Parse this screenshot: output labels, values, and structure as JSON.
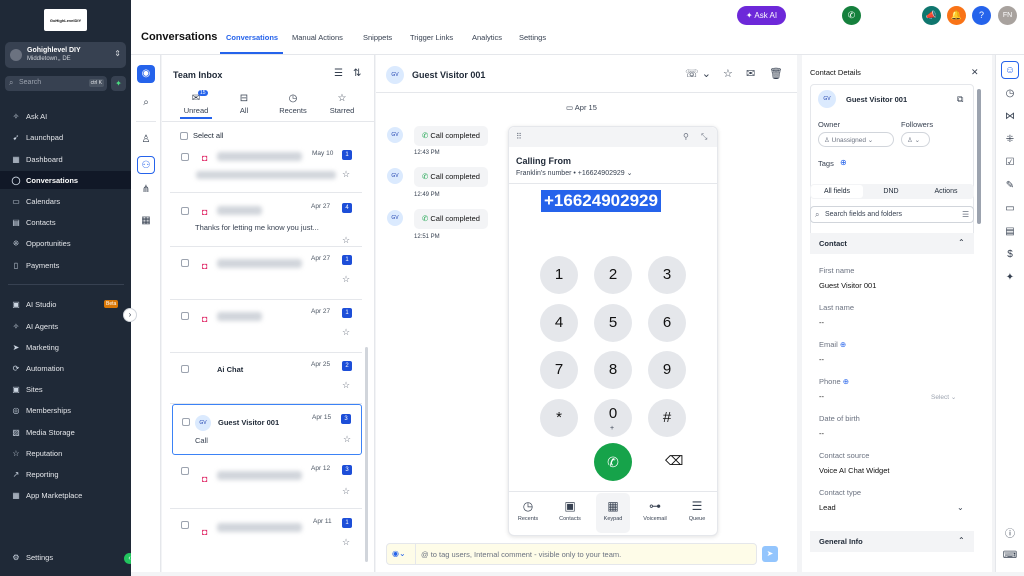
{
  "sidebar": {
    "logo_text": "GoHighLevelDIY",
    "location_name": "Gohighlevel DIY",
    "location_sub": "Middletown,, DE",
    "search_placeholder": "Search",
    "search_shortcut": "ctrl K",
    "items": [
      {
        "label": "Ask AI",
        "icon": "sparkle-icon"
      },
      {
        "label": "Launchpad",
        "icon": "rocket-icon"
      },
      {
        "label": "Dashboard",
        "icon": "grid-icon"
      },
      {
        "label": "Conversations",
        "icon": "chat-icon"
      },
      {
        "label": "Calendars",
        "icon": "calendar-icon"
      },
      {
        "label": "Contacts",
        "icon": "contacts-icon"
      },
      {
        "label": "Opportunities",
        "icon": "funnel-icon"
      },
      {
        "label": "Payments",
        "icon": "payments-icon"
      },
      {
        "label": "AI Studio",
        "icon": "ai-studio-icon"
      },
      {
        "label": "AI Agents",
        "icon": "ai-agents-icon"
      },
      {
        "label": "Marketing",
        "icon": "send-icon"
      },
      {
        "label": "Automation",
        "icon": "automation-icon"
      },
      {
        "label": "Sites",
        "icon": "sites-icon"
      },
      {
        "label": "Memberships",
        "icon": "memberships-icon"
      },
      {
        "label": "Media Storage",
        "icon": "media-icon"
      },
      {
        "label": "Reputation",
        "icon": "reputation-icon"
      },
      {
        "label": "Reporting",
        "icon": "reporting-icon"
      },
      {
        "label": "App Marketplace",
        "icon": "marketplace-icon"
      }
    ],
    "beta_badge": "Beta",
    "settings_label": "Settings"
  },
  "header": {
    "title": "Conversations",
    "tabs": [
      "Conversations",
      "Manual Actions",
      "Snippets",
      "Trigger Links",
      "Analytics",
      "Settings"
    ],
    "ask_ai": "Ask AI",
    "user_initials": "FN"
  },
  "inbox": {
    "title": "Team Inbox",
    "tabs": [
      {
        "label": "Unread",
        "badge": "15"
      },
      {
        "label": "All"
      },
      {
        "label": "Recents"
      },
      {
        "label": "Starred"
      }
    ],
    "select_all": "Select all",
    "rows": [
      {
        "date": "May 10",
        "count": "1",
        "preview": ""
      },
      {
        "date": "Apr 27",
        "count": "4",
        "preview": "Thanks for letting me know you just..."
      },
      {
        "date": "Apr 27",
        "count": "1",
        "preview": ""
      },
      {
        "date": "Apr 27",
        "count": "1",
        "preview": ""
      },
      {
        "name": "Ai Chat",
        "date": "Apr 25",
        "count": "2",
        "preview": ""
      },
      {
        "name": "Guest Visitor 001",
        "date": "Apr 15",
        "count": "3",
        "preview": "Call",
        "avatar": "GV"
      },
      {
        "date": "Apr 12",
        "count": "3",
        "preview": ""
      },
      {
        "date": "Apr 11",
        "count": "1",
        "preview": ""
      }
    ]
  },
  "conversation": {
    "contact_initials": "GV",
    "contact_name": "Guest Visitor 001",
    "date_divider": "Apr 15",
    "messages": [
      {
        "text": "Call completed",
        "time": "12:43 PM"
      },
      {
        "text": "Call completed",
        "time": "12:49 PM"
      },
      {
        "text": "Call completed",
        "time": "12:51 PM"
      }
    ],
    "compose_placeholder": "@ to tag users, Internal comment - visible only to your team."
  },
  "dialer": {
    "title": "Calling From",
    "from": "Franklin's number • +16624902929",
    "number": "+16624902929",
    "keys": [
      "1",
      "2",
      "3",
      "4",
      "5",
      "6",
      "7",
      "8",
      "9",
      "*",
      "0",
      "#"
    ],
    "zero_sub": "+",
    "tabs": [
      "Recents",
      "Contacts",
      "Keypad",
      "Voicemail",
      "Queue"
    ]
  },
  "contact": {
    "panel_title": "Contact Details",
    "name": "Guest Visitor 001",
    "initials": "GV",
    "owner_label": "Owner",
    "owner_value": "Unassigned",
    "followers_label": "Followers",
    "tags_label": "Tags",
    "tabs": [
      "All fields",
      "DND",
      "Actions"
    ],
    "search_placeholder": "Search fields and folders",
    "section": "Contact",
    "fields": [
      {
        "label": "First name",
        "value": "Guest Visitor 001"
      },
      {
        "label": "Last name",
        "value": "--"
      },
      {
        "label": "Email",
        "value": "--"
      },
      {
        "label": "Phone",
        "value": "--"
      },
      {
        "label": "Date of birth",
        "value": "--"
      },
      {
        "label": "Contact source",
        "value": "Voice AI Chat Widget"
      },
      {
        "label": "Contact type",
        "value": "Lead"
      }
    ],
    "phone_select": "Select",
    "general_info": "General Info"
  }
}
